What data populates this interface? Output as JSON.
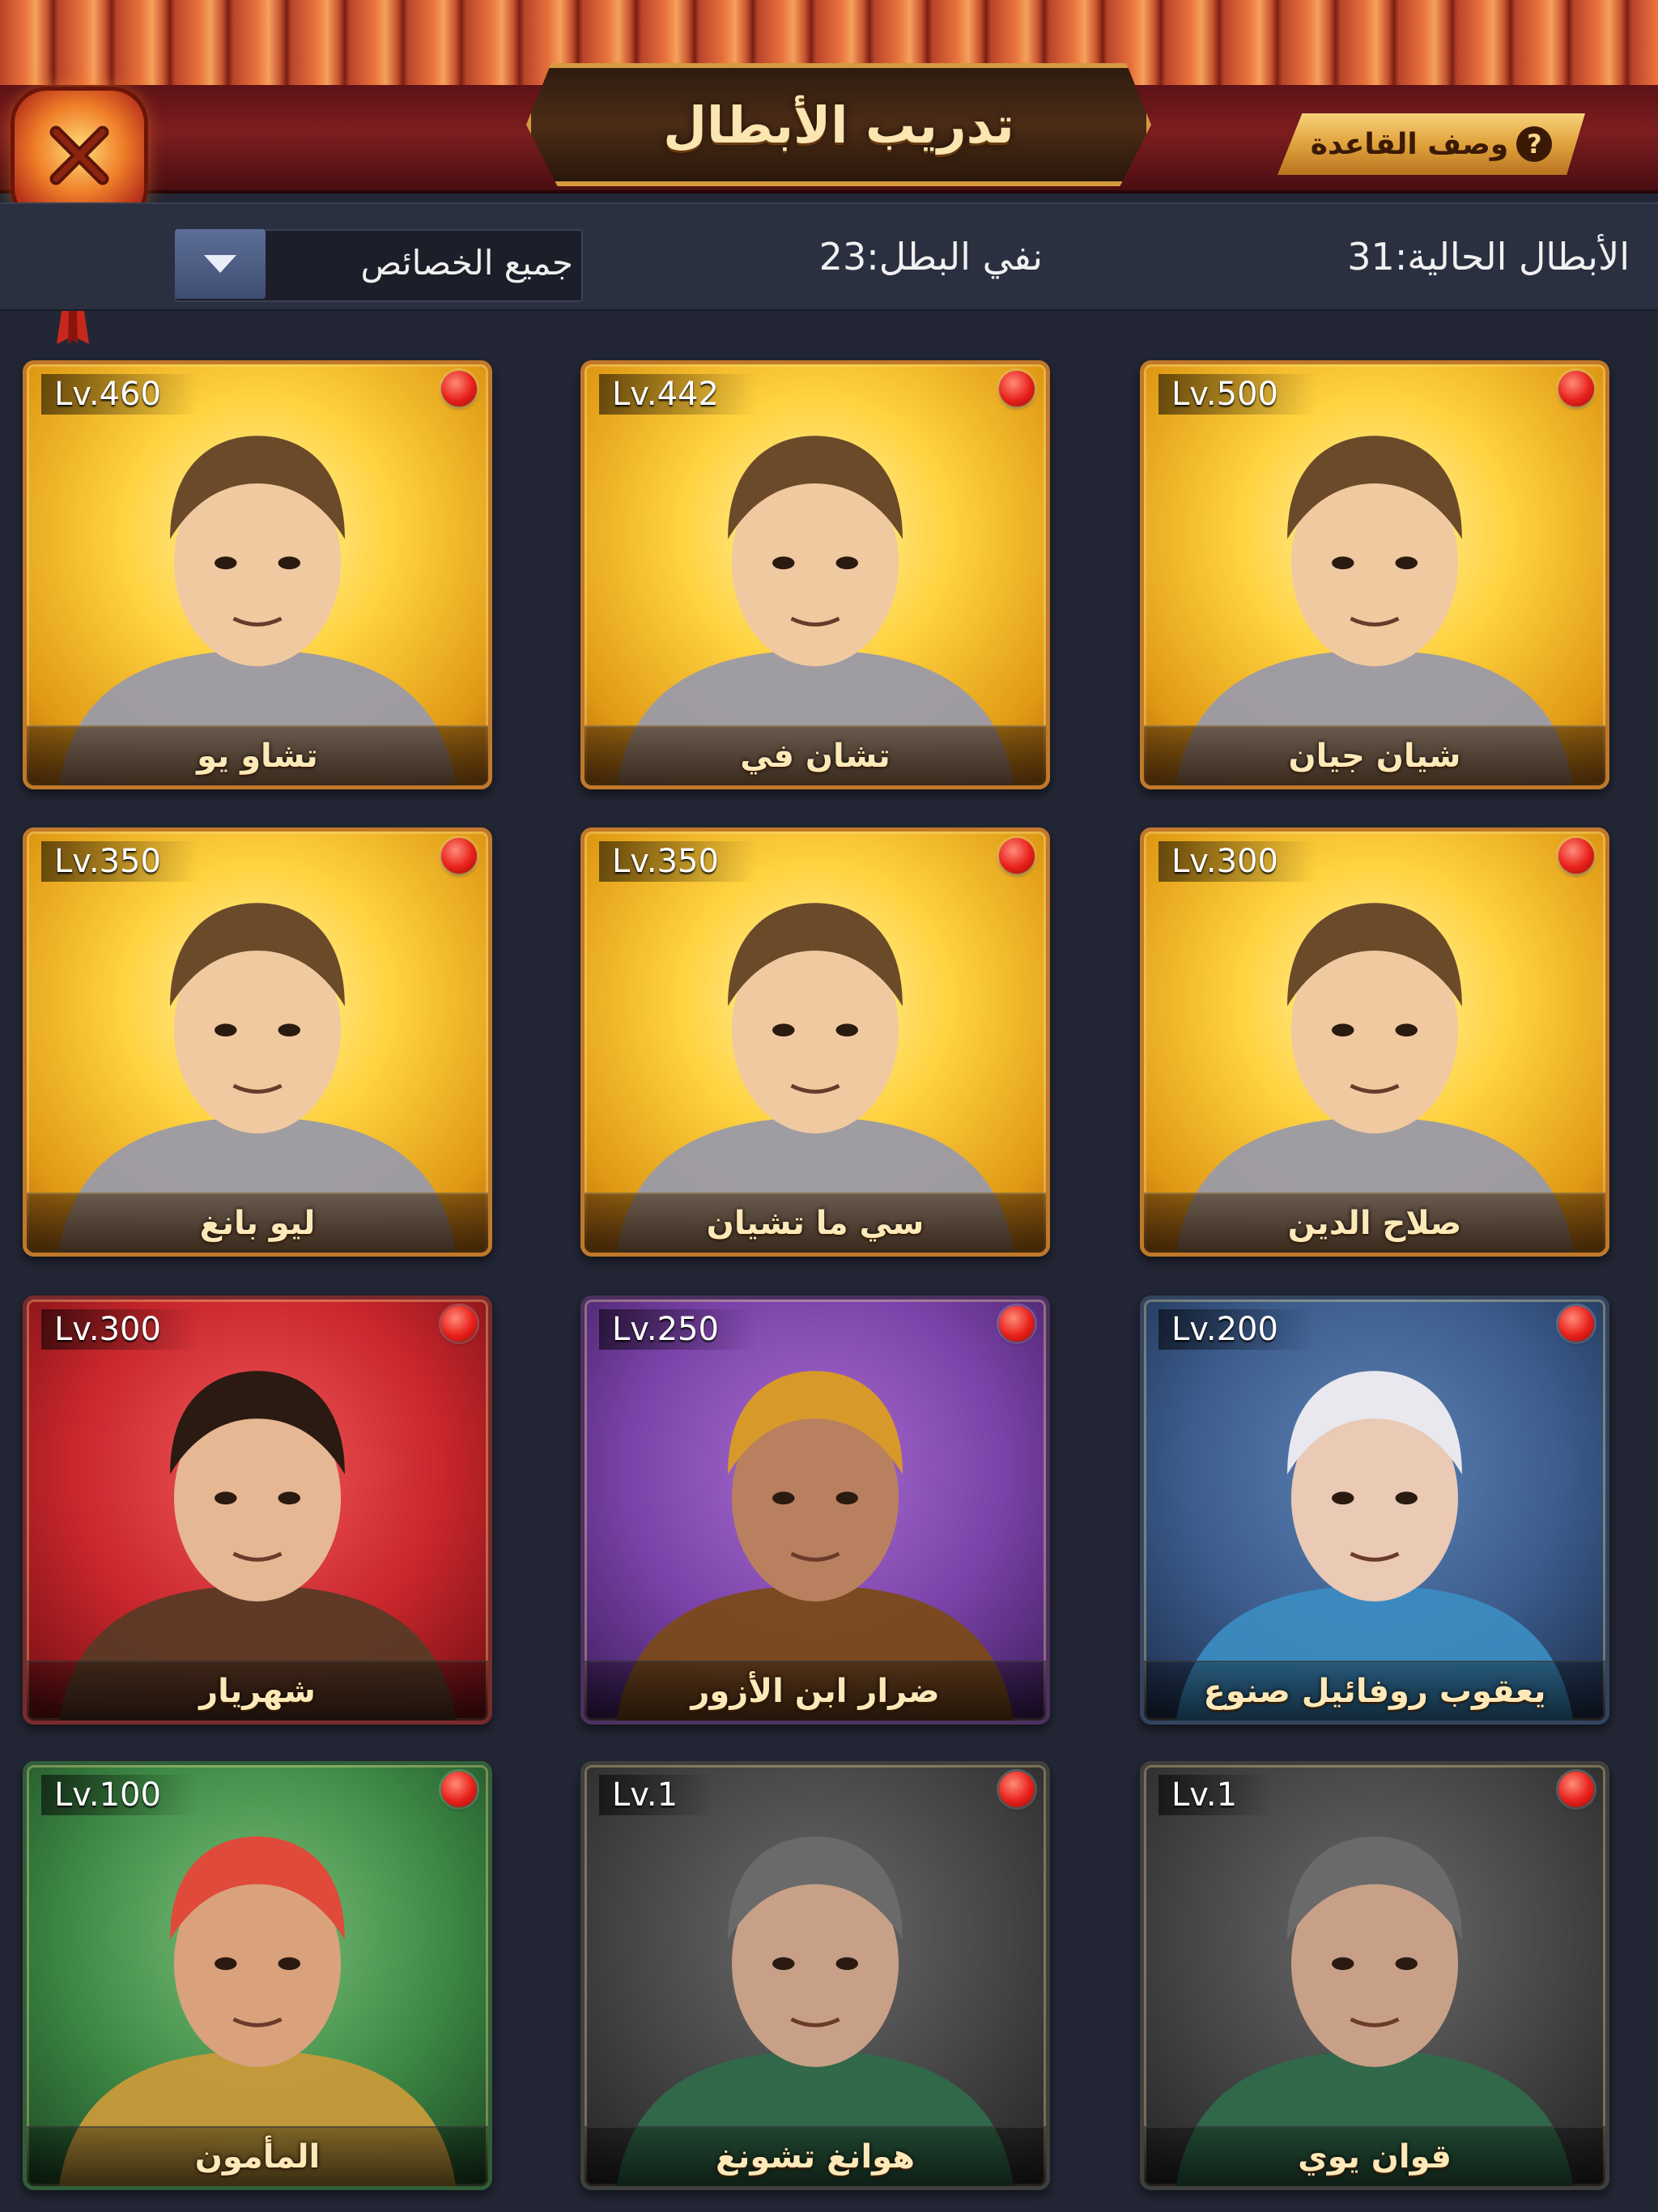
{
  "header": {
    "title": "تدريب الأبطال",
    "rule_button_label": "وصف القاعدة",
    "rule_button_icon": "?",
    "close_icon": "close-icon"
  },
  "stats": {
    "current_heroes": "الأبطال الحالية:31",
    "exiled_heroes": "نفي البطل:23",
    "filter_selected": "جميع الخصائص"
  },
  "colors": {
    "background": "#232735",
    "banner": "#7d1d20",
    "gold_frame": "#c0782a",
    "notification_dot": "#e8201a"
  },
  "heroes": [
    {
      "name": "شيان جيان",
      "level": "Lv.500",
      "frame": "gold"
    },
    {
      "name": "تشان في",
      "level": "Lv.442",
      "frame": "gold"
    },
    {
      "name": "تشاو يو",
      "level": "Lv.460",
      "frame": "gold"
    },
    {
      "name": "صلاح الدين",
      "level": "Lv.300",
      "frame": "gold"
    },
    {
      "name": "سي ما تشيان",
      "level": "Lv.350",
      "frame": "gold"
    },
    {
      "name": "ليو بانغ",
      "level": "Lv.350",
      "frame": "gold"
    },
    {
      "name": "يعقوب روفائيل صنوع",
      "level": "Lv.200",
      "frame": "blue"
    },
    {
      "name": "ضرار ابن الأزور",
      "level": "Lv.250",
      "frame": "purple"
    },
    {
      "name": "شهريار",
      "level": "Lv.300",
      "frame": "red"
    },
    {
      "name": "قوان يوي",
      "level": "Lv.1",
      "frame": "grey"
    },
    {
      "name": "هوانغ تشونغ",
      "level": "Lv.1",
      "frame": "grey"
    },
    {
      "name": "المأمون",
      "level": "Lv.100",
      "frame": "green"
    }
  ]
}
